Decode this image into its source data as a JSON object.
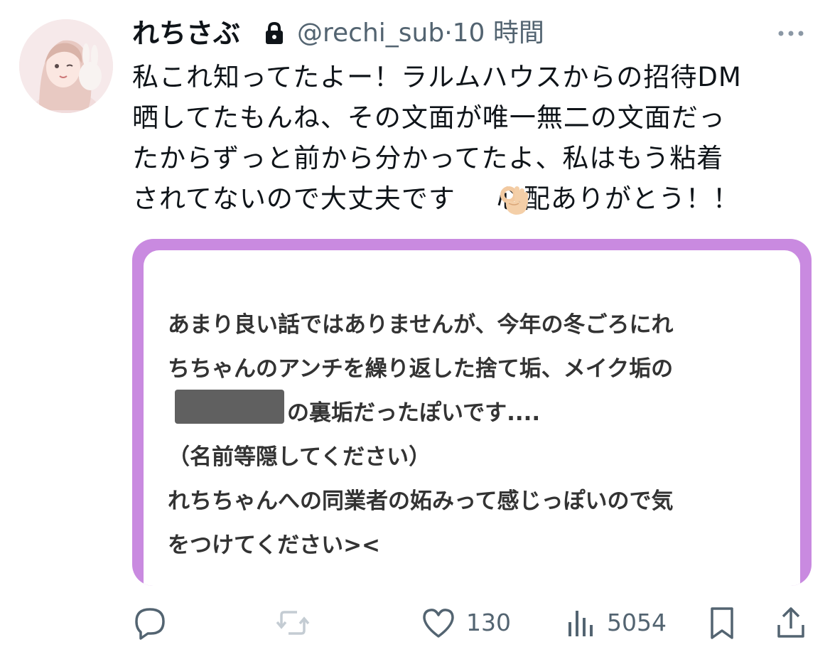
{
  "tweet": {
    "display_name": "れちさぶ",
    "handle": "@rechi_sub",
    "separator": "·",
    "time": "10 時間",
    "text": "私これ知ってたよー！ラルムハウスからの招待DM\n晒してたもんね、その文面が唯一無二の文面だっ\nたからずっと前から分かってたよ、私はもう粘着\nされてないので大丈夫です",
    "text_tail": "心配ありがとう！！",
    "emoji_icon": "ok-hand-icon",
    "locked_icon": "lock-icon"
  },
  "media": {
    "line1": "あまり良い話ではありませんが、今年の冬ごろにれ",
    "line2": "ちちゃんのアンチを繰り返した捨て垢、メイク垢の",
    "line3": "の裏垢だったぽいです....",
    "line4": "（名前等隠してください）",
    "line5": "れちちゃんへの同業者の妬みって感じっぽいので気",
    "line6": "をつけてください><",
    "border_color": "#c98ae0",
    "redaction_color": "#606060"
  },
  "actions": {
    "reply_icon": "reply-icon",
    "retweet_icon": "retweet-icon",
    "like_icon": "heart-icon",
    "like_count": "130",
    "views_icon": "views-icon",
    "views_count": "5054",
    "bookmark_icon": "bookmark-icon",
    "share_icon": "share-icon"
  }
}
